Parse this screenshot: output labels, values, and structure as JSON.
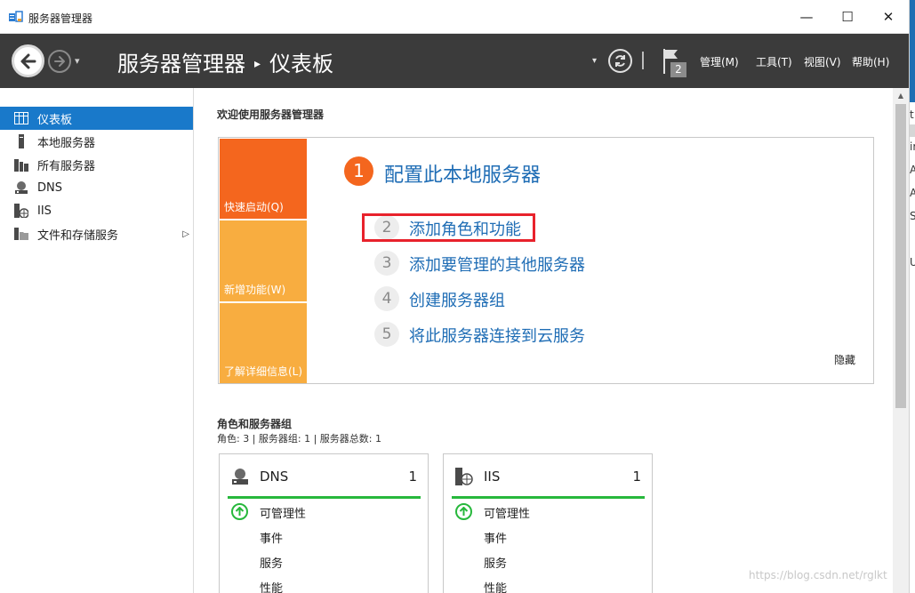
{
  "window": {
    "title": "服务器管理器",
    "minimize": "—",
    "maximize": "☐",
    "close": "✕"
  },
  "header": {
    "breadcrumb_root": "服务器管理器",
    "breadcrumb_sep": "▸",
    "breadcrumb_current": "仪表板",
    "dropdown_glyph": "▾",
    "notification_count": "2",
    "menus": [
      "管理(M)",
      "工具(T)",
      "视图(V)",
      "帮助(H)"
    ]
  },
  "sidebar": {
    "items": [
      {
        "label": "仪表板",
        "icon": "dashboard-icon",
        "active": true
      },
      {
        "label": "本地服务器",
        "icon": "local-server-icon"
      },
      {
        "label": "所有服务器",
        "icon": "all-servers-icon"
      },
      {
        "label": "DNS",
        "icon": "dns-icon"
      },
      {
        "label": "IIS",
        "icon": "iis-icon"
      },
      {
        "label": "文件和存储服务",
        "icon": "file-storage-icon",
        "expandable": true
      }
    ],
    "expand_glyph": "▷"
  },
  "welcome": {
    "heading": "欢迎使用服务器管理器",
    "tiles": [
      "快速启动(Q)",
      "新增功能(W)",
      "了解详细信息(L)"
    ],
    "step1_number": "1",
    "step1_title": "配置此本地服务器",
    "steps": [
      {
        "number": "2",
        "label": "添加角色和功能"
      },
      {
        "number": "3",
        "label": "添加要管理的其他服务器"
      },
      {
        "number": "4",
        "label": "创建服务器组"
      },
      {
        "number": "5",
        "label": "将此服务器连接到云服务"
      }
    ],
    "hide": "隐藏"
  },
  "roles": {
    "heading": "角色和服务器组",
    "summary": "角色: 3 | 服务器组: 1 | 服务器总数: 1",
    "cards": [
      {
        "title": "DNS",
        "count": "1",
        "rows": [
          "可管理性",
          "事件",
          "服务",
          "性能"
        ],
        "icon": "dns-icon",
        "status": "ok"
      },
      {
        "title": "IIS",
        "count": "1",
        "rows": [
          "可管理性",
          "事件",
          "服务",
          "性能"
        ],
        "icon": "iis-icon",
        "status": "ok"
      }
    ]
  },
  "right_strip_chars": [
    "t",
    "ir",
    "A",
    "A",
    "Su",
    "U"
  ],
  "watermark": "https://blog.csdn.net/rglkt",
  "colors": {
    "header_bg": "#3b3b3b",
    "sidebar_active": "#1979ca",
    "tile_primary": "#f4661e",
    "tile_secondary": "#f8ad40",
    "link_blue": "#1f6db5",
    "status_green": "#27b83c",
    "highlight_red": "#e8222c"
  }
}
